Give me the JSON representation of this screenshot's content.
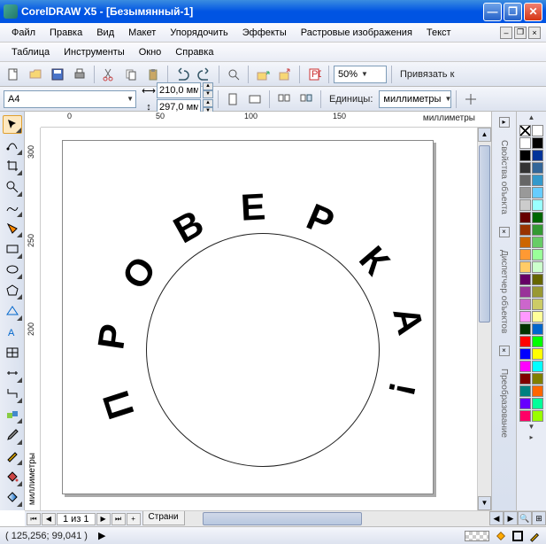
{
  "title": "CorelDRAW X5 - [Безымянный-1]",
  "menu": {
    "file": "Файл",
    "edit": "Правка",
    "view": "Вид",
    "layout": "Макет",
    "arrange": "Упорядочить",
    "effects": "Эффекты",
    "bitmap": "Растровые изображения",
    "text": "Текст",
    "table": "Таблица",
    "tools": "Инструменты",
    "window": "Окно",
    "help": "Справка"
  },
  "toolbar1": {
    "zoom": "50%",
    "snap": "Привязать к"
  },
  "toolbar2": {
    "paper": "A4",
    "width": "210,0 мм",
    "height": "297,0 мм",
    "units_label": "Единицы:",
    "units": "миллиметры"
  },
  "ruler": {
    "h": [
      "0",
      "50",
      "100",
      "150"
    ],
    "v": [
      "300",
      "250",
      "200"
    ],
    "hlabel": "миллиметры",
    "vlabel": "миллиметры"
  },
  "canvas": {
    "text_on_path": [
      "П",
      "Р",
      "О",
      "В",
      "Е",
      "Р",
      "К",
      "А",
      "!"
    ]
  },
  "pagenav": {
    "page_of": "1 из 1",
    "tab": "Страни"
  },
  "dockers": {
    "props": "Свойства объекта",
    "mgr": "Диспетчер объектов",
    "transform": "Преобразование"
  },
  "palette": [
    "#ffffff",
    "#000000",
    "#000000",
    "#003399",
    "#333333",
    "#336699",
    "#666666",
    "#3399cc",
    "#999999",
    "#66ccff",
    "#cccccc",
    "#99ffff",
    "#660000",
    "#006600",
    "#993300",
    "#339933",
    "#cc6600",
    "#66cc66",
    "#ff9933",
    "#99ff99",
    "#ffcc66",
    "#ccffcc",
    "#660066",
    "#666600",
    "#993399",
    "#999933",
    "#cc66cc",
    "#cccc66",
    "#ff99ff",
    "#ffff99",
    "#003300",
    "#0066cc",
    "#ff0000",
    "#00ff00",
    "#0000ff",
    "#ffff00",
    "#ff00ff",
    "#00ffff",
    "#800000",
    "#808000",
    "#008080",
    "#ff6600",
    "#6600ff",
    "#00ff99",
    "#ff0066",
    "#99ff00",
    "#0099ff",
    "#cc0099"
  ],
  "status": {
    "coords": "( 125,256; 99,041 )"
  }
}
